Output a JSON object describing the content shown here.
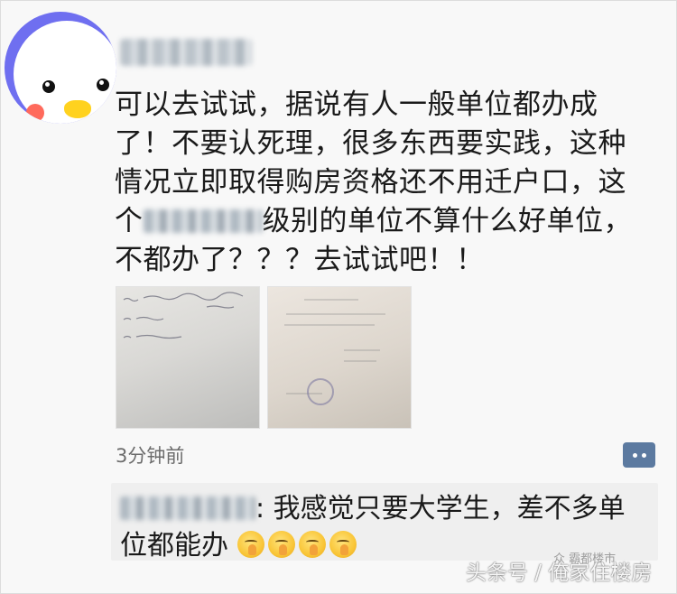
{
  "post": {
    "lines": [
      "可以去试试，据说有人一般单位都办成",
      "了！不要认死理，很多东西要实践，这种",
      "情况立即取得购房资格还不用迁户口，这",
      "级别的单位不算什么好单位，",
      "不都办了？？？去试试吧！！"
    ],
    "line4_prefix": "个",
    "timestamp": "3分钟前"
  },
  "comment": {
    "separator": ":",
    "line1": " 我感觉只要大学生，差不多单",
    "line2": "位都能办"
  },
  "watermark": {
    "main": "头条号 / 俺家住楼房",
    "small": "众 霸都楼市"
  },
  "icons": {
    "avatar": "penguin-avatar-icon",
    "more": "more-options-icon",
    "emoji": "grimace-emoji-icon"
  },
  "colors": {
    "avatar_bg": "#6f6ff0",
    "more_button": "#5c7aa0",
    "timestamp": "#6c6c6c"
  }
}
